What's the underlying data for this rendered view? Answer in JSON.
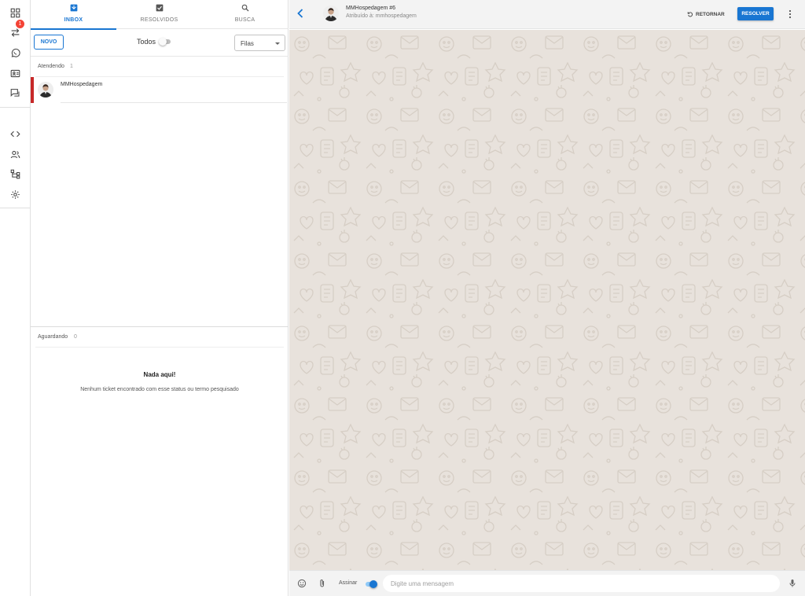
{
  "colors": {
    "primary": "#1976d2",
    "accent_red": "#c62828",
    "badge": "#f44336",
    "chat_bg": "#e8e2dc"
  },
  "rail": {
    "items": [
      {
        "name": "dashboard-icon"
      },
      {
        "name": "tickets-icon",
        "badge": "1"
      },
      {
        "name": "whatsapp-icon"
      },
      {
        "name": "contacts-icon"
      },
      {
        "name": "quick-answers-icon"
      },
      {
        "name": "code-icon"
      },
      {
        "name": "users-icon"
      },
      {
        "name": "queues-icon"
      },
      {
        "name": "settings-icon"
      }
    ]
  },
  "tabs": [
    {
      "label": "INBOX",
      "icon": "inbox-icon",
      "active": true
    },
    {
      "label": "RESOLVIDOS",
      "icon": "check-box-icon",
      "active": false
    },
    {
      "label": "BUSCA",
      "icon": "search-icon",
      "active": false
    }
  ],
  "toolbar": {
    "new_label": "NOVO",
    "toggle_label": "Todos",
    "queue_select": "Filas"
  },
  "sections": {
    "open": {
      "title": "Atendendo",
      "count": "1"
    },
    "pending": {
      "title": "Aguardando",
      "count": "0"
    }
  },
  "tickets": [
    {
      "name": "MMHospedagem"
    }
  ],
  "empty": {
    "title": "Nada aqui!",
    "subtitle": "Nenhum ticket encontrado com esse status ou termo pesquisado"
  },
  "chat": {
    "contact_name": "MMHospedagem #6",
    "assigned": "Atribuído à: mmhospedagem",
    "return_label": "RETORNAR",
    "resolve_label": "RESOLVER"
  },
  "composer": {
    "sign_label": "Assinar",
    "placeholder": "Digite uma mensagem"
  }
}
